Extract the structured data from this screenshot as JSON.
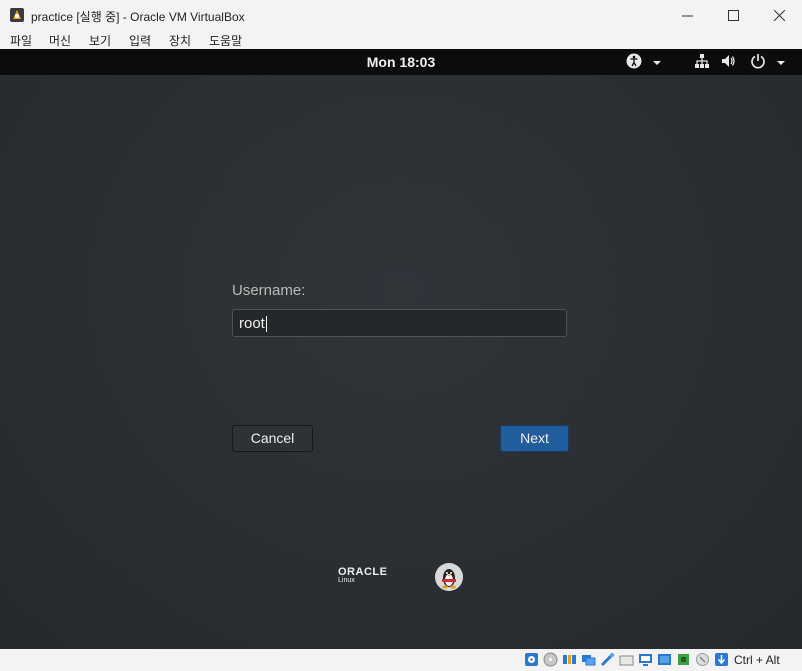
{
  "window": {
    "title": "practice [실행 중] - Oracle VM VirtualBox",
    "controls": {
      "minimize": "—",
      "maximize": "☐",
      "close": "✕"
    }
  },
  "menu": {
    "items": [
      {
        "label": "파일"
      },
      {
        "label": "머신"
      },
      {
        "label": "보기"
      },
      {
        "label": "입력"
      },
      {
        "label": "장치"
      },
      {
        "label": "도움말"
      }
    ]
  },
  "guest": {
    "topbar": {
      "clock": "Mon 18:03",
      "icons": [
        "accessibility-icon",
        "network-icon",
        "volume-icon",
        "power-icon"
      ]
    },
    "login": {
      "username_label": "Username:",
      "username_value": "root",
      "cancel_label": "Cancel",
      "next_label": "Next"
    },
    "branding": {
      "oracle": "ORACLE",
      "linux": "Linux"
    }
  },
  "statusbar": {
    "host_key": "Ctrl + Alt"
  }
}
